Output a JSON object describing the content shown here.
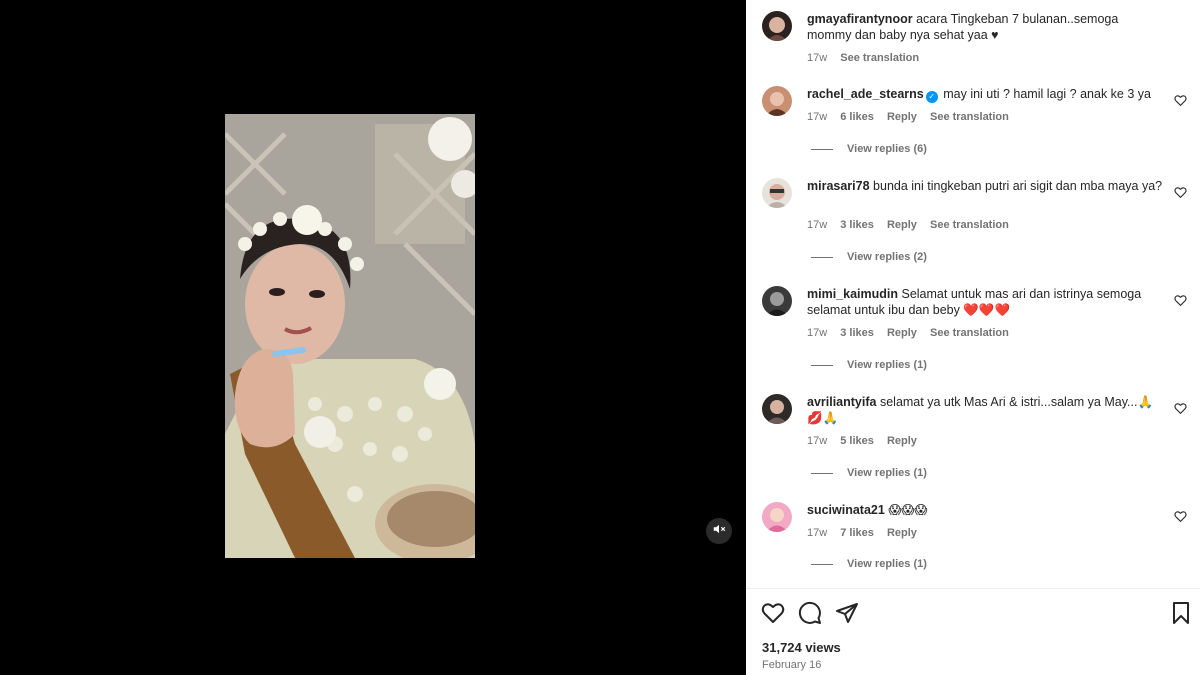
{
  "video": {
    "mute_icon": "speaker-muted-icon"
  },
  "caption": {
    "username": "gmayafirantynoor",
    "text": "acara Tingkeban 7 bulanan..semoga mommy dan baby nya sehat yaa ♥",
    "time": "17w",
    "see_translation": "See translation"
  },
  "comments": [
    {
      "username": "rachel_ade_stearns",
      "verified": true,
      "text": "may ini uti ? hamil lagi ? anak ke 3 ya",
      "time": "17w",
      "likes": "6 likes",
      "reply": "Reply",
      "see_translation": "See translation",
      "view_replies": "View replies (6)"
    },
    {
      "username": "mirasari78",
      "text": "bunda ini tingkeban putri ari sigit dan mba maya ya?",
      "time": "17w",
      "likes": "3 likes",
      "reply": "Reply",
      "see_translation": "See translation",
      "view_replies": "View replies (2)"
    },
    {
      "username": "mimi_kaimudin",
      "text": "Selamat untuk mas ari dan istrinya semoga selamat untuk ibu dan beby ❤️❤️❤️",
      "time": "17w",
      "likes": "3 likes",
      "reply": "Reply",
      "see_translation": "See translation",
      "view_replies": "View replies (1)"
    },
    {
      "username": "avriliantyifa",
      "text": "selamat ya utk Mas Ari & istri...salam ya May...🙏 💋🙏",
      "time": "17w",
      "likes": "5 likes",
      "reply": "Reply",
      "view_replies": "View replies (1)"
    },
    {
      "username": "suciwinata21",
      "text": "😱😱😱",
      "time": "17w",
      "likes": "7 likes",
      "reply": "Reply",
      "view_replies": "View replies (1)"
    }
  ],
  "actions": {
    "like_icon": "heart-icon",
    "comment_icon": "comment-bubble-icon",
    "share_icon": "paper-plane-icon",
    "save_icon": "bookmark-icon",
    "views": "31,724 views",
    "date": "February 16"
  },
  "colors": {
    "accent": "#0095f6",
    "muted_text": "#737373",
    "heart_red": "#ed4956"
  }
}
